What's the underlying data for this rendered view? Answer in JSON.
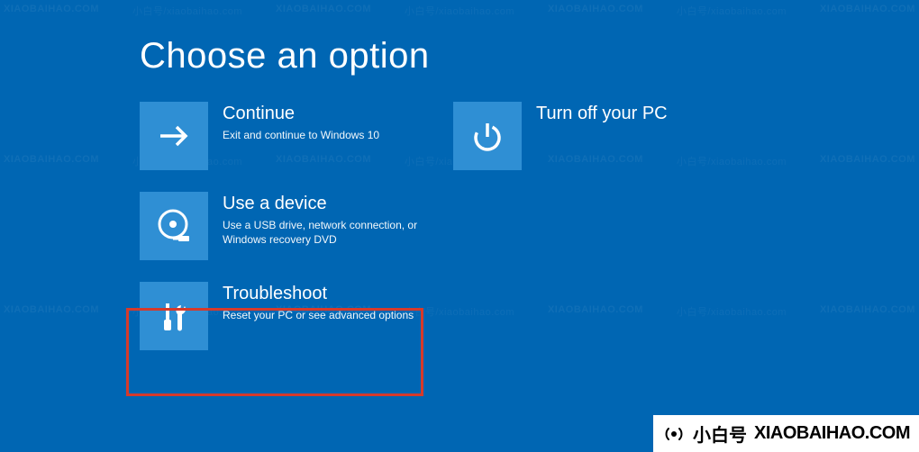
{
  "title": "Choose an option",
  "tiles": {
    "continue": {
      "title": "Continue",
      "desc": "Exit and continue to Windows 10"
    },
    "use_device": {
      "title": "Use a device",
      "desc": "Use a USB drive, network connection, or Windows recovery DVD"
    },
    "troubleshoot": {
      "title": "Troubleshoot",
      "desc": "Reset your PC or see advanced options"
    },
    "turn_off": {
      "title": "Turn off your PC",
      "desc": ""
    }
  },
  "watermark": {
    "text": "XIAOBAIHAO.COM",
    "diag": "小白号/xiaobaihao.com"
  },
  "badge": {
    "brand": "小白号",
    "url": "XIAOBAIHAO.COM"
  }
}
